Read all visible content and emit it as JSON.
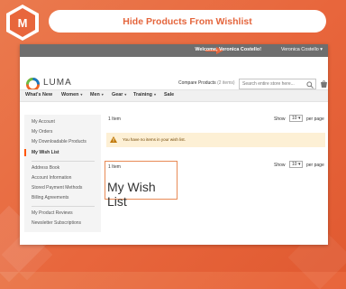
{
  "banner": {
    "title": "Hide Products From Wishlist",
    "accent": "#e8663c"
  },
  "topbar": {
    "welcome": "Welcome, Veronica Costello!",
    "user": "Veronica Costello"
  },
  "header": {
    "logo_text": "LUMA",
    "compare_label": "Compare Products",
    "compare_count": "(2 items)",
    "search_placeholder": "Search entire store here..."
  },
  "nav": [
    {
      "label": "What's New",
      "caret": ""
    },
    {
      "label": "Women",
      "caret": "▾"
    },
    {
      "label": "Men",
      "caret": "▾"
    },
    {
      "label": "Gear",
      "caret": "▾"
    },
    {
      "label": "Training",
      "caret": "▾"
    },
    {
      "label": "Sale",
      "caret": ""
    }
  ],
  "sidebar": {
    "group1": [
      "My Account",
      "My Orders",
      "My Downloadable Products",
      "My Wish List"
    ],
    "group2": [
      "Address Book",
      "Account Information",
      "Stored Payment Methods",
      "Billing Agreements"
    ],
    "group3": [
      "My Product Reviews",
      "Newsletter Subscriptions"
    ],
    "active": "My Wish List"
  },
  "toolbar_top": {
    "count": "1 Item",
    "show_label": "Show",
    "limit": "10",
    "per_page": "per page"
  },
  "notice": {
    "text": "You have no items in your wish list."
  },
  "toolbar_bottom": {
    "count": "1 Item",
    "show_label": "Show",
    "limit": "10",
    "per_page": "per page"
  },
  "page_title": "My Wish List"
}
